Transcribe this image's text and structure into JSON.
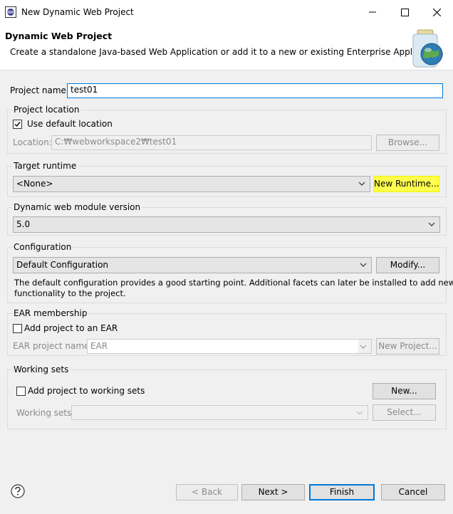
{
  "window": {
    "title": "New Dynamic Web Project"
  },
  "header": {
    "title": "Dynamic Web Project",
    "description": "Create a standalone Java-based Web Application or add it to a new or existing Enterprise Application."
  },
  "project_name": {
    "label": "Project name:",
    "value": "test01"
  },
  "project_location": {
    "title": "Project location",
    "use_default_label": "Use default location",
    "use_default_checked": true,
    "location_label": "Location:",
    "location_value": "C:₩webworkspace2₩test01",
    "browse_label": "Browse..."
  },
  "target_runtime": {
    "title": "Target runtime",
    "selected": "<None>",
    "new_runtime_label": "New Runtime..."
  },
  "web_module": {
    "title": "Dynamic web module version",
    "selected": "5.0"
  },
  "configuration": {
    "title": "Configuration",
    "selected": "Default Configuration",
    "modify_label": "Modify...",
    "description_line1": "The default configuration provides a good starting point. Additional facets can later be installed to add new",
    "description_line2": "functionality to the project."
  },
  "ear": {
    "title": "EAR membership",
    "add_label": "Add project to an EAR",
    "add_checked": false,
    "project_name_label": "EAR project name:",
    "project_name_value": "EAR",
    "new_project_label": "New Project..."
  },
  "working_sets": {
    "title": "Working sets",
    "add_label": "Add project to working sets",
    "add_checked": false,
    "new_label": "New...",
    "sets_label": "Working sets:",
    "select_label": "Select..."
  },
  "footer": {
    "back_label": "< Back",
    "next_label": "Next >",
    "finish_label": "Finish",
    "cancel_label": "Cancel"
  }
}
